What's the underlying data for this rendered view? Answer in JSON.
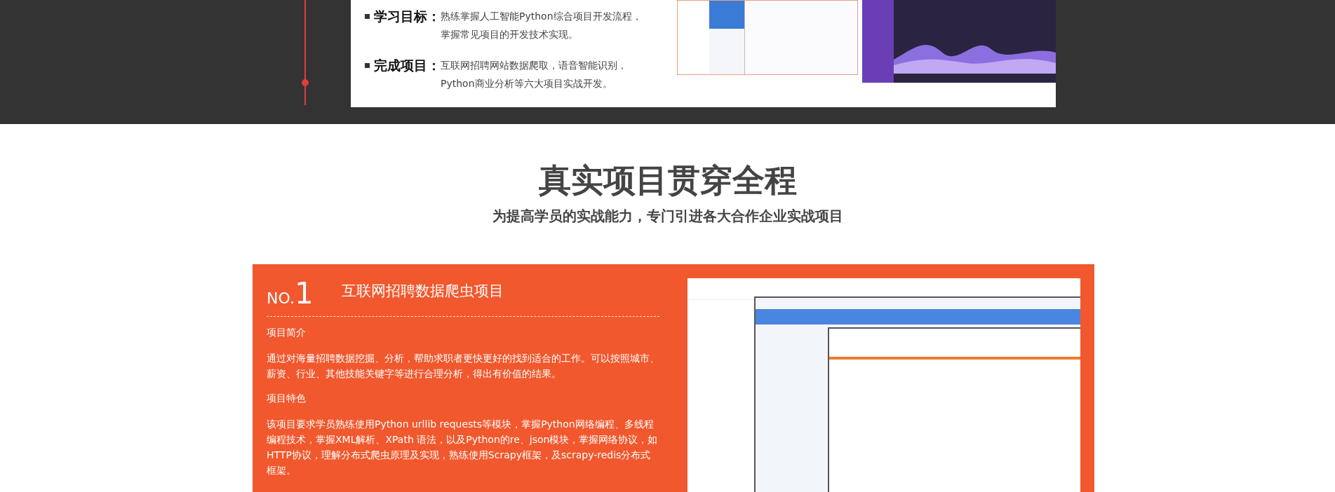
{
  "intro": {
    "items": [
      {
        "label": "学习目标：",
        "lines": [
          "熟练掌握人工智能Python综合项目开发流程，",
          "掌握常见项目的开发技术实现。"
        ]
      },
      {
        "label": "完成项目：",
        "lines": [
          "互联网招聘网站数据爬取，语音智能识别，",
          "Python商业分析等六大项目实战开发。"
        ]
      }
    ]
  },
  "section": {
    "title": "真实项目贯穿全程",
    "subtitle": "为提高学员的实战能力，专门引进各大合作企业实战项目"
  },
  "project": {
    "no_prefix": "NO.",
    "no_number": "1",
    "title": "互联网招聘数据爬虫项目",
    "blocks": [
      {
        "kind": "heading",
        "text": "项目简介"
      },
      {
        "kind": "paragraph",
        "text": "通过对海量招聘数据挖掘、分析，帮助求职者更快更好的找到适合的工作。可以按照城市、薪资、行业、其他技能关键字等进行合理分析，得出有价值的结果。"
      },
      {
        "kind": "heading",
        "text": "项目特色"
      },
      {
        "kind": "paragraph",
        "text": "该项目要求学员熟练使用Python urllib requests等模块，掌握Python网络编程、多线程编程技术，掌握XML解析、XPath 语法，以及Python的re、json模块，掌握网络协议，如HTTP协议，理解分布式爬虫原理及实现，熟练使用Scrapy框架，及scrapy-redis分布式框架。"
      }
    ]
  }
}
